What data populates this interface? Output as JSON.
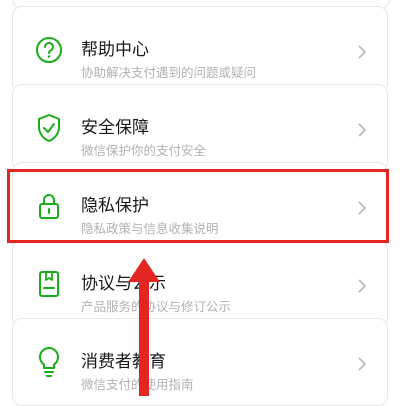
{
  "menu": {
    "items": [
      {
        "title": "帮助中心",
        "subtitle": "协助解决支付遇到的问题或疑问",
        "icon": "help-circle-icon"
      },
      {
        "title": "安全保障",
        "subtitle": "微信保护你的支付安全",
        "icon": "shield-check-icon"
      },
      {
        "title": "隐私保护",
        "subtitle": "隐私政策与信息收集说明",
        "icon": "padlock-icon"
      },
      {
        "title": "协议与公示",
        "subtitle": "产品服务的协议与修订公示",
        "icon": "document-icon"
      },
      {
        "title": "消费者教育",
        "subtitle": "微信支付的使用指南",
        "icon": "lightbulb-icon"
      }
    ]
  },
  "colors": {
    "accent": "#1aad19",
    "title": "#191919",
    "subtitle": "#b2b2b2",
    "annotation": "#e32622"
  }
}
